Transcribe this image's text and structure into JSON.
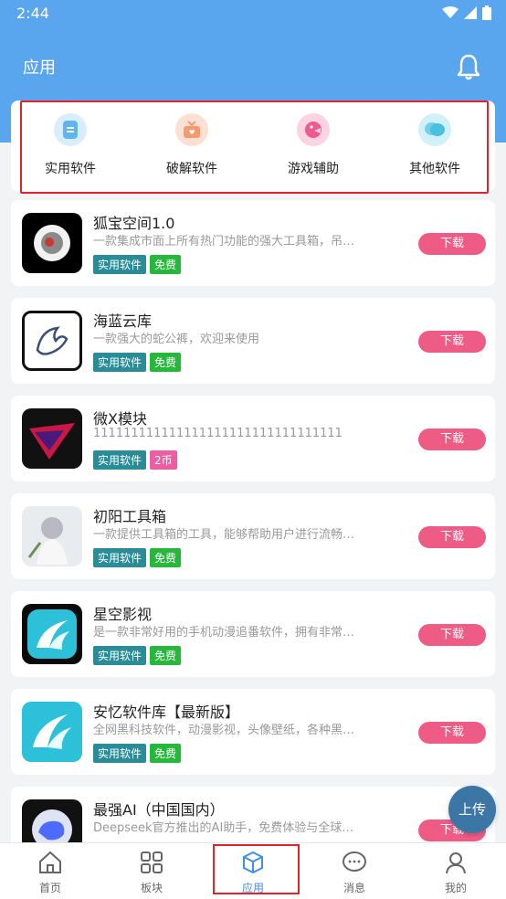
{
  "status": {
    "time": "2:44"
  },
  "header": {
    "title": "应用"
  },
  "categories": [
    {
      "label": "实用软件",
      "icon": "document-icon",
      "color": "#5fb6ef"
    },
    {
      "label": "破解软件",
      "icon": "gift-icon",
      "color": "#f79a6f"
    },
    {
      "label": "游戏辅助",
      "icon": "game-icon",
      "color": "#ef5a8e"
    },
    {
      "label": "其他软件",
      "icon": "chat-bubbles-icon",
      "color": "#6fd1ea"
    }
  ],
  "apps": [
    {
      "name": "狐宝空间1.0",
      "desc": "一款集成市面上所有热门功能的强大工具箱，吊…",
      "tag1": "实用软件",
      "tag2": "免费",
      "download": "下载"
    },
    {
      "name": "海蓝云库",
      "desc": "一款强大的蛇公裤，欢迎来使用",
      "tag1": "实用软件",
      "tag2": "免费",
      "download": "下载"
    },
    {
      "name": "微X模块",
      "desc": "111111111111111111111111111111111",
      "tag1": "实用软件",
      "tag2": "2币",
      "download": "下载"
    },
    {
      "name": "初阳工具箱",
      "desc": "一款提供工具箱的工具，能够帮助用户进行流畅…",
      "tag1": "实用软件",
      "tag2": "免费",
      "download": "下载"
    },
    {
      "name": "星空影视",
      "desc": "是一款非常好用的手机动漫追番软件，拥有非常…",
      "tag1": "实用软件",
      "tag2": "免费",
      "download": "下载"
    },
    {
      "name": "安忆软件库【最新版】",
      "desc": "全网黑科技软件，动漫影视，头像壁纸，各种黑…",
      "tag1": "实用软件",
      "tag2": "免费",
      "download": "下载"
    },
    {
      "name": "最强AI（中国国内）",
      "desc": "Deepseek官方推出的AI助手，免费体验与全球…",
      "download": "下载"
    }
  ],
  "float_button": "上传",
  "tabs": [
    {
      "label": "首页",
      "icon": "home-icon"
    },
    {
      "label": "板块",
      "icon": "grid-icon"
    },
    {
      "label": "应用",
      "icon": "cube-icon"
    },
    {
      "label": "消息",
      "icon": "message-icon"
    },
    {
      "label": "我的",
      "icon": "user-icon"
    }
  ],
  "colors": {
    "primary": "#5aa6ee",
    "download": "#ee5c86",
    "tag_category": "#2a8c96",
    "tag_free": "#25b83a",
    "tag_coin": "#ee5ca3",
    "tab_active": "#3f8ef0"
  }
}
